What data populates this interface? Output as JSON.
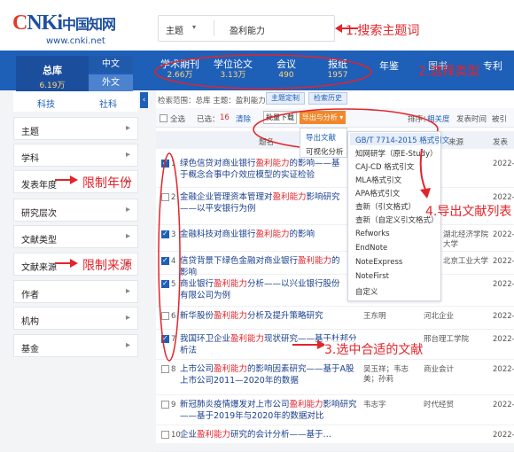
{
  "header": {
    "logo_text": "CNKI中国知网",
    "logo_url": "www.cnki.net",
    "search_scope": "主题",
    "search_query": "盈利能力"
  },
  "annotations": {
    "a1": "1.搜索主题词",
    "a2": "2.选择类型",
    "a3": "3.选中合适的文献",
    "a4": "4.导出文献列表",
    "year": "限制年份",
    "source": "限制来源"
  },
  "nav": {
    "all": {
      "label": "总库",
      "count": "6.19万"
    },
    "zh": "中文",
    "foreign": "外文",
    "tabs": [
      {
        "label": "学术期刊",
        "count": "2.66万"
      },
      {
        "label": "学位论文",
        "count": "3.13万"
      },
      {
        "label": "会议",
        "count": "490"
      },
      {
        "label": "报纸",
        "count": "1957"
      },
      {
        "label": "年鉴",
        "count": ""
      },
      {
        "label": "图书",
        "count": ""
      },
      {
        "label": "专利",
        "count": ""
      }
    ]
  },
  "sidebar": {
    "subtabs": [
      "科技",
      "社科"
    ],
    "items": [
      "主题",
      "学科",
      "发表年度",
      "研究层次",
      "文献类型",
      "文献来源",
      "作者",
      "机构",
      "基金"
    ]
  },
  "results": {
    "scope_text": "检索范围：总库  主题：盈利能力",
    "btn_topic": "主题定制",
    "btn_history": "检索历史",
    "select_all": "全选",
    "selected": "已选：",
    "selected_count": "16",
    "clear": "清除",
    "batch_download": "批量下载",
    "export": "导出与分析",
    "sort_label": "排序：",
    "sort_rel": "相关度",
    "sort_time": "发表时间",
    "sort_cite": "被引",
    "col_title": "题名",
    "col_source": "来源",
    "col_date": "发表",
    "rows": [
      {
        "n": "1",
        "checked": true,
        "title": "绿色信贷对商业银行盈利能力的影响——基于概念合事中介效应模型的实证检验",
        "author": "",
        "source": "",
        "date": "2022-"
      },
      {
        "n": "2",
        "checked": false,
        "title": "金融企业管理资本管理对盈利能力影响研究——以平安银行为例",
        "author": "",
        "source": "",
        "date": "2022-"
      },
      {
        "n": "3",
        "checked": true,
        "title": "金融科技对商业银行盈利能力的影响",
        "author": "",
        "source": "湖北经济学院大学",
        "date": "2022-"
      },
      {
        "n": "4",
        "checked": true,
        "title": "信贷背景下绿色金融对商业银行盈利能力的影响",
        "author": "",
        "source": "北京工业大学",
        "date": "2022-"
      },
      {
        "n": "5",
        "checked": true,
        "title": "商业银行盈利能力分析——以兴业银行股份有限公司为例",
        "author": "",
        "source": "",
        "date": "2022-"
      },
      {
        "n": "6",
        "checked": false,
        "title": "新华股份盈利能力分析及提升策略研究",
        "author": "王东明",
        "source": "河北企业",
        "date": "2022-"
      },
      {
        "n": "7",
        "checked": true,
        "title": "我国环卫企业盈利能力现状研究——基于杜邦分析法",
        "author": "",
        "source": "邢台理工学院",
        "date": "2022-"
      },
      {
        "n": "8",
        "checked": false,
        "title": "上市公司盈利能力的影响因素研究——基于A股上市公司2011—2020年的数据",
        "author": "吴玉祥；韦志美；孙莉",
        "source": "商业会计",
        "date": "2022-"
      },
      {
        "n": "9",
        "checked": false,
        "title": "新冠肺炎疫情爆发对上市公司盈利能力影响研究——基于2019年与2020年的数据对比",
        "author": "韦志字",
        "source": "时代经贸",
        "date": "2022-"
      },
      {
        "n": "10",
        "checked": false,
        "title": "企业盈利能力研究的会计分析——基于…",
        "author": "",
        "source": "",
        "date": "2022-"
      }
    ]
  },
  "export_menu": {
    "header": "导出文献",
    "analysis": "可视化分析",
    "items": [
      "GB/T 7714-2015 格式引文",
      "知网研学（原E-Study）",
      "CAJ-CD 格式引文",
      "MLA格式引文",
      "APA格式引文",
      "查新（引文格式）",
      "查新（自定义引文格式）",
      "Refworks",
      "EndNote",
      "NoteExpress",
      "NoteFirst",
      "自定义"
    ]
  },
  "colors": {
    "brand": "#1e5fb8",
    "accent": "#e3242b",
    "orange": "#f0882a"
  }
}
